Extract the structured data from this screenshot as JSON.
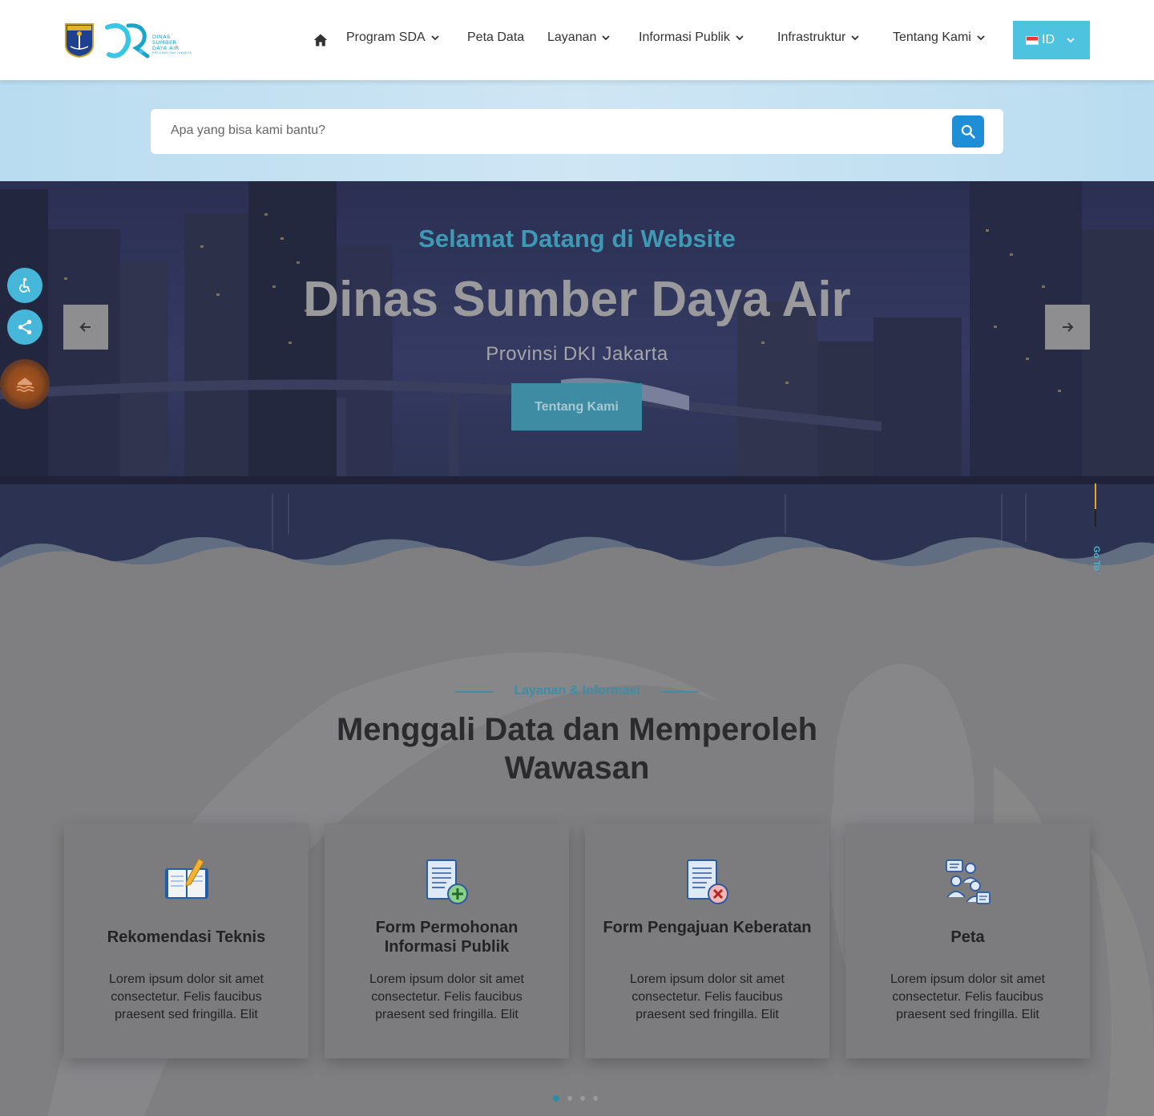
{
  "header": {
    "logo_line1": "DINAS",
    "logo_line2": "SUMBER",
    "logo_line3": "DAYA AIR",
    "logo_line4": "PROVINSI DKI JAKARTA",
    "nav": [
      {
        "label": "Program SDA",
        "dropdown": true
      },
      {
        "label": "Peta Data",
        "dropdown": false
      },
      {
        "label": "Layanan",
        "dropdown": true
      },
      {
        "label": "Informasi Publik",
        "dropdown": true
      },
      {
        "label": "Infrastruktur",
        "dropdown": true
      },
      {
        "label": "Tentang Kami",
        "dropdown": true
      }
    ],
    "lang": "ID",
    "home_icon": "home-icon"
  },
  "search": {
    "placeholder": "Apa yang bisa kami bantu?",
    "icon": "search-icon"
  },
  "hero": {
    "subtitle": "Selamat Datang di Website",
    "title": "Dinas Sumber Daya Air",
    "region": "Provinsi DKI Jakarta",
    "button": "Tentang Kami"
  },
  "side_buttons": [
    "accessibility-icon",
    "share-icon",
    "flood-icon"
  ],
  "gotop": "Go To Top",
  "section": {
    "kicker": "Layanan & Informasi",
    "title": "Menggali Data dan Memperoleh Wawasan",
    "cards": [
      {
        "title": "Rekomendasi Teknis",
        "text": "Lorem ipsum dolor sit amet consectetur. Felis faucibus praesent sed fringilla. Elit",
        "icon": "notebook-pencil-icon"
      },
      {
        "title": "Form Permohonan Informasi Publik",
        "text": "Lorem ipsum dolor sit amet consectetur. Felis faucibus praesent sed fringilla. Elit",
        "icon": "document-add-icon"
      },
      {
        "title": "Form Pengajuan Keberatan",
        "text": "Lorem ipsum dolor sit amet consectetur. Felis faucibus praesent sed fringilla. Elit",
        "icon": "document-reject-icon"
      },
      {
        "title": "Peta",
        "text": "Lorem ipsum dolor sit amet consectetur. Felis faucibus praesent sed fringilla. Elit",
        "icon": "people-group-icon"
      }
    ]
  },
  "colors": {
    "accent": "#4ec3e0",
    "primary_blue": "#1e8fd6",
    "kicker": "#3b8ea6"
  }
}
